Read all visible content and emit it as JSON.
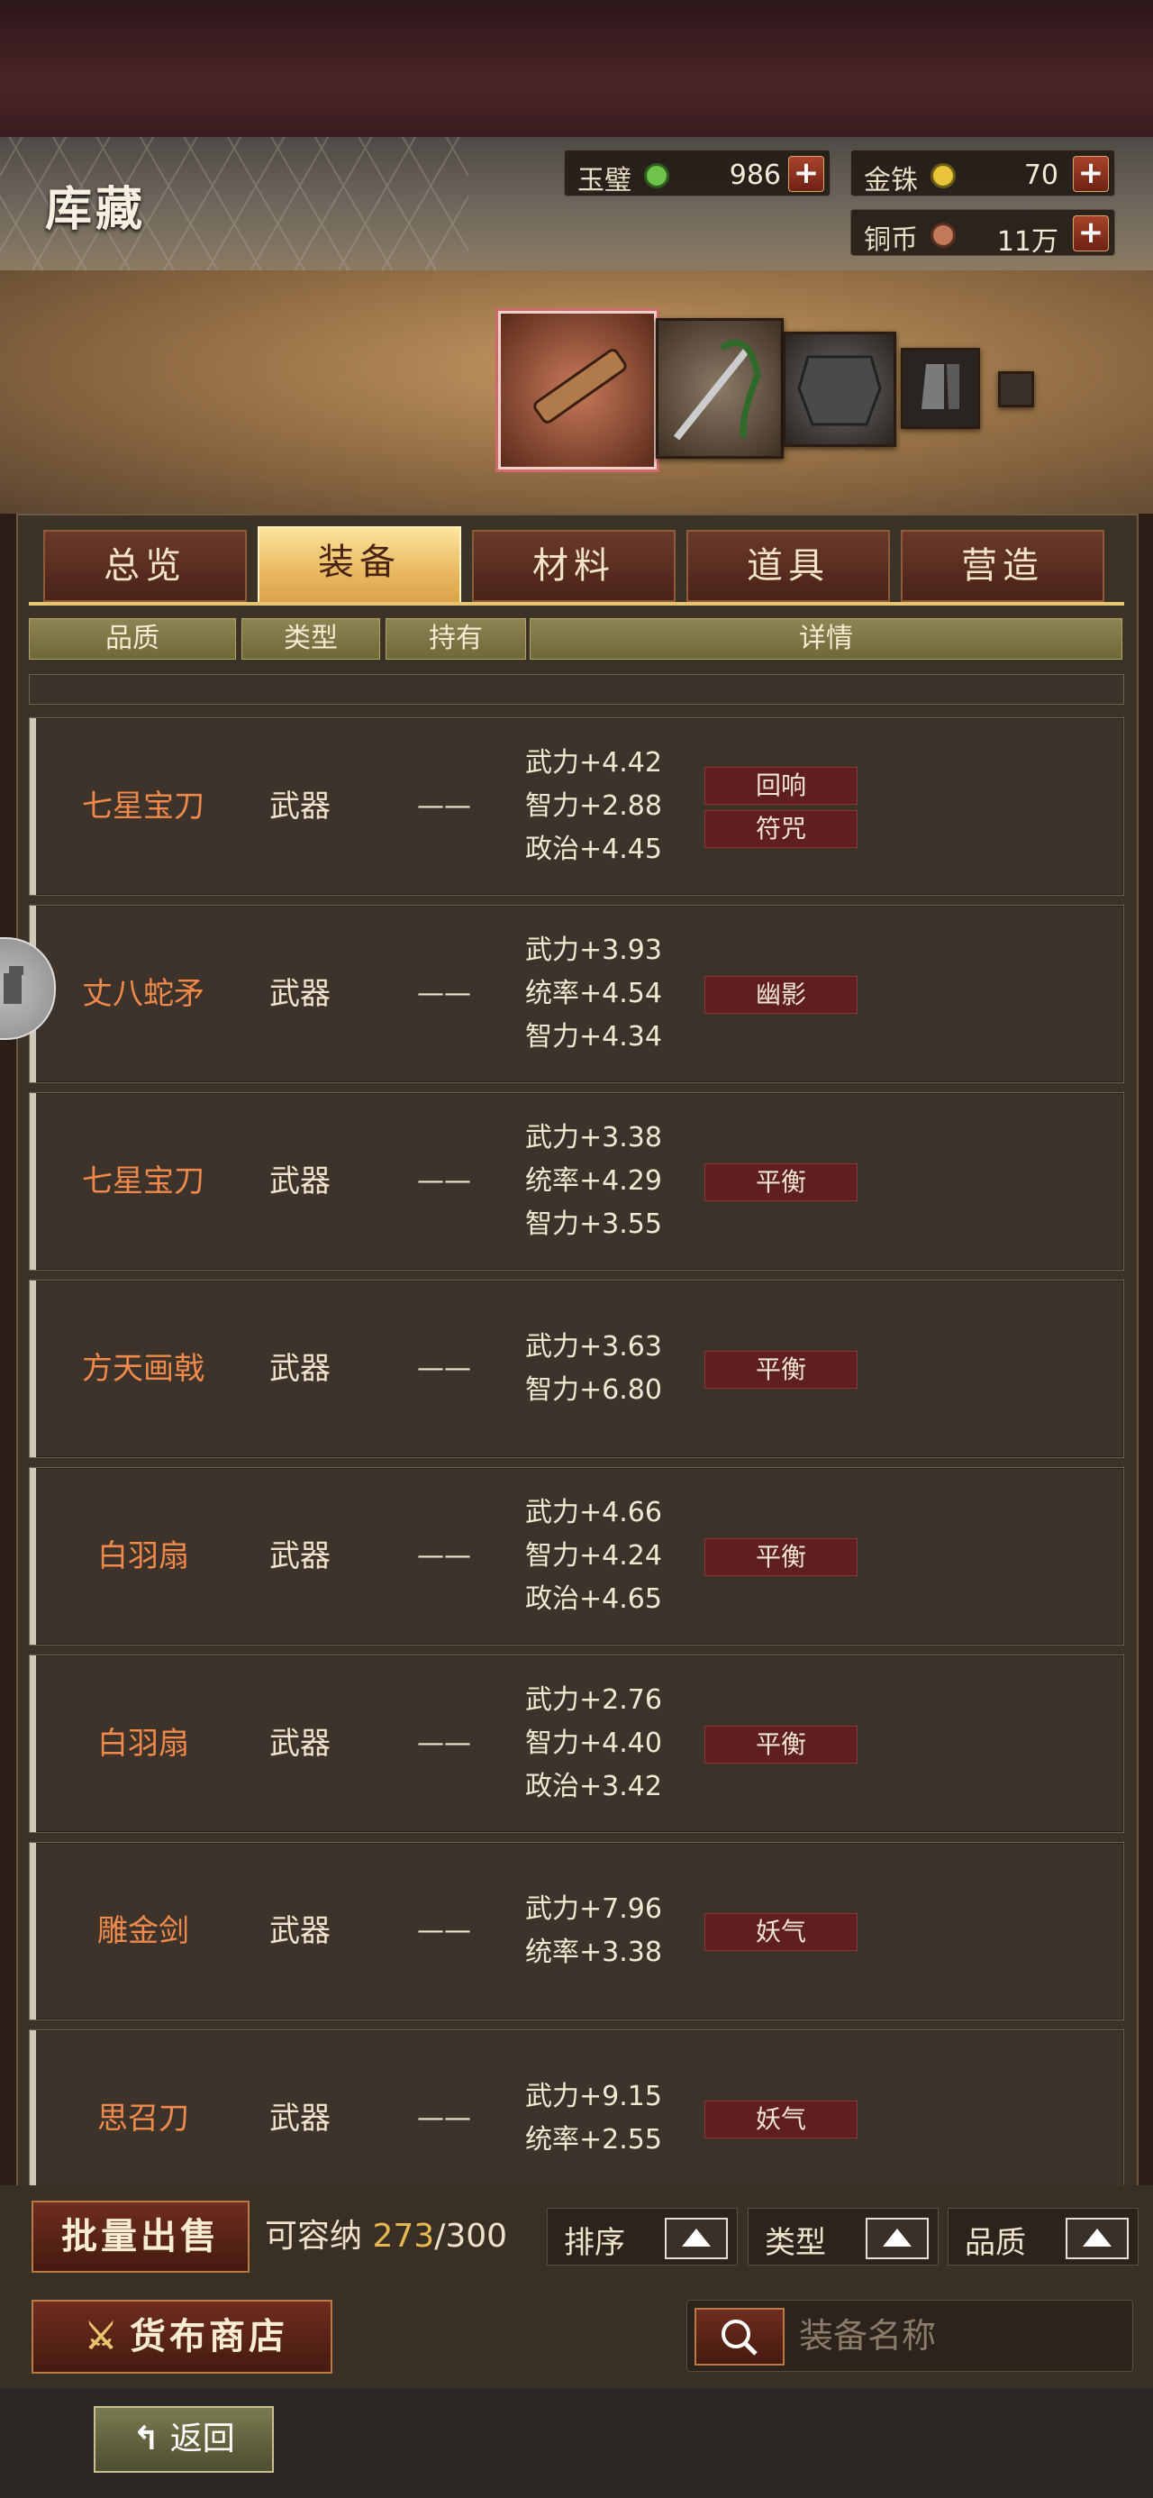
{
  "header": {
    "title": "库藏"
  },
  "currencies": [
    {
      "label": "玉璧",
      "value": "986",
      "color": "#6fc24a"
    },
    {
      "label": "金铢",
      "value": "70",
      "color": "#e8c43a"
    },
    {
      "label": "铜币",
      "value": "11万",
      "color": "#c07a5a"
    }
  ],
  "tabs": [
    "总览",
    "装备",
    "材料",
    "道具",
    "营造"
  ],
  "active_tab": "装备",
  "columns": [
    "品质",
    "类型",
    "持有",
    "详情"
  ],
  "items": [
    {
      "name": "七星宝刀",
      "type": "武器",
      "holder": "——",
      "stats": [
        "武力+4.42",
        "智力+2.88",
        "政治+4.45"
      ],
      "tags": [
        "回响",
        "符咒"
      ]
    },
    {
      "name": "丈八蛇矛",
      "type": "武器",
      "holder": "——",
      "stats": [
        "武力+3.93",
        "统率+4.54",
        "智力+4.34"
      ],
      "tags": [
        "幽影"
      ]
    },
    {
      "name": "七星宝刀",
      "type": "武器",
      "holder": "——",
      "stats": [
        "武力+3.38",
        "统率+4.29",
        "智力+3.55"
      ],
      "tags": [
        "平衡"
      ]
    },
    {
      "name": "方天画戟",
      "type": "武器",
      "holder": "——",
      "stats": [
        "武力+3.63",
        "智力+6.80"
      ],
      "tags": [
        "平衡"
      ]
    },
    {
      "name": "白羽扇",
      "type": "武器",
      "holder": "——",
      "stats": [
        "武力+4.66",
        "智力+4.24",
        "政治+4.65"
      ],
      "tags": [
        "平衡"
      ]
    },
    {
      "name": "白羽扇",
      "type": "武器",
      "holder": "——",
      "stats": [
        "武力+2.76",
        "智力+4.40",
        "政治+3.42"
      ],
      "tags": [
        "平衡"
      ]
    },
    {
      "name": "雕金剑",
      "type": "武器",
      "holder": "——",
      "stats": [
        "武力+7.96",
        "统率+3.38"
      ],
      "tags": [
        "妖气"
      ]
    },
    {
      "name": "思召刀",
      "type": "武器",
      "holder": "——",
      "stats": [
        "武力+9.15",
        "统率+2.55"
      ],
      "tags": [
        "妖气"
      ]
    }
  ],
  "footer": {
    "bulk_sell": "批量出售",
    "capacity_label": "可容纳",
    "capacity_used": "273",
    "capacity_total": "/300",
    "sort_label": "排序",
    "type_label": "类型",
    "quality_label": "品质",
    "shop_label": "货布商店",
    "search_placeholder": "装备名称",
    "back_label": "返回"
  }
}
